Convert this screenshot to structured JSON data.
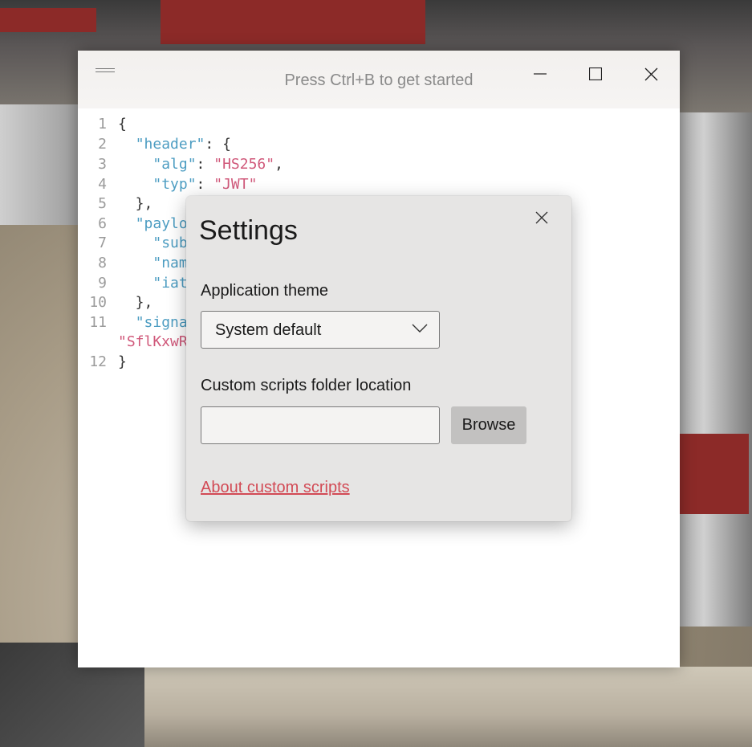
{
  "window": {
    "title": "Press Ctrl+B to get started"
  },
  "editor": {
    "lines": [
      {
        "num": "1",
        "tokens": [
          {
            "t": "p",
            "v": "{"
          }
        ]
      },
      {
        "num": "2",
        "tokens": [
          {
            "t": "p",
            "v": "  "
          },
          {
            "t": "k",
            "v": "\"header\""
          },
          {
            "t": "p",
            "v": ": {"
          }
        ]
      },
      {
        "num": "3",
        "tokens": [
          {
            "t": "p",
            "v": "    "
          },
          {
            "t": "k",
            "v": "\"alg\""
          },
          {
            "t": "p",
            "v": ": "
          },
          {
            "t": "s",
            "v": "\"HS256\""
          },
          {
            "t": "p",
            "v": ","
          }
        ]
      },
      {
        "num": "4",
        "tokens": [
          {
            "t": "p",
            "v": "    "
          },
          {
            "t": "k",
            "v": "\"typ\""
          },
          {
            "t": "p",
            "v": ": "
          },
          {
            "t": "s",
            "v": "\"JWT\""
          }
        ]
      },
      {
        "num": "5",
        "tokens": [
          {
            "t": "p",
            "v": "  },"
          }
        ]
      },
      {
        "num": "6",
        "tokens": [
          {
            "t": "p",
            "v": "  "
          },
          {
            "t": "k",
            "v": "\"paylo"
          }
        ]
      },
      {
        "num": "7",
        "tokens": [
          {
            "t": "p",
            "v": "    "
          },
          {
            "t": "k",
            "v": "\"sub"
          }
        ]
      },
      {
        "num": "8",
        "tokens": [
          {
            "t": "p",
            "v": "    "
          },
          {
            "t": "k",
            "v": "\"nam"
          }
        ]
      },
      {
        "num": "9",
        "tokens": [
          {
            "t": "p",
            "v": "    "
          },
          {
            "t": "k",
            "v": "\"iat"
          }
        ]
      },
      {
        "num": "10",
        "tokens": [
          {
            "t": "p",
            "v": "  },"
          }
        ]
      },
      {
        "num": "11",
        "tokens": [
          {
            "t": "p",
            "v": "  "
          },
          {
            "t": "k",
            "v": "\"signa"
          }
        ]
      },
      {
        "num": "",
        "tokens": [
          {
            "t": "s",
            "v": "\"SflKxwR"
          }
        ]
      },
      {
        "num": "12",
        "tokens": [
          {
            "t": "p",
            "v": "}"
          }
        ]
      }
    ]
  },
  "settings": {
    "title": "Settings",
    "theme_label": "Application theme",
    "theme_value": "System default",
    "scripts_label": "Custom scripts folder location",
    "scripts_value": "",
    "browse_label": "Browse",
    "about_link": "About custom scripts"
  },
  "colors": {
    "link": "#d24a55",
    "json_key": "#4d9dc2",
    "json_string": "#d0587a"
  }
}
